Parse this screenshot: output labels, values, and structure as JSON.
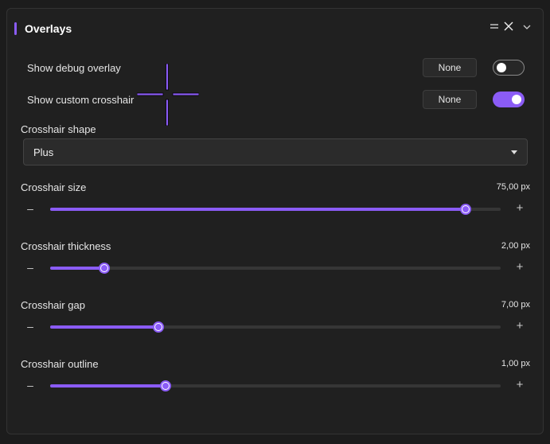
{
  "colors": {
    "accent": "#8b5cf6",
    "panel_bg": "#202020",
    "crosshair": "#8b5cf6"
  },
  "header": {
    "title": "Overlays",
    "icons": [
      "drag-handle-icon",
      "close-icon",
      "chevron-down-icon"
    ]
  },
  "debug_overlay": {
    "label": "Show debug overlay",
    "key_label": "None",
    "enabled": false
  },
  "custom_crosshair": {
    "label": "Show custom crosshair",
    "key_label": "None",
    "enabled": true
  },
  "crosshair_shape": {
    "label": "Crosshair shape",
    "selected": "Plus"
  },
  "sliders": [
    {
      "label": "Crosshair size",
      "value_text": "75,00 px",
      "fraction": 0.922
    },
    {
      "label": "Crosshair thickness",
      "value_text": "2,00 px",
      "fraction": 0.12
    },
    {
      "label": "Crosshair gap",
      "value_text": "7,00 px",
      "fraction": 0.24
    },
    {
      "label": "Crosshair outline",
      "value_text": "1,00 px",
      "fraction": 0.256
    }
  ],
  "slider_buttons": {
    "minus": "–",
    "plus": "+"
  }
}
